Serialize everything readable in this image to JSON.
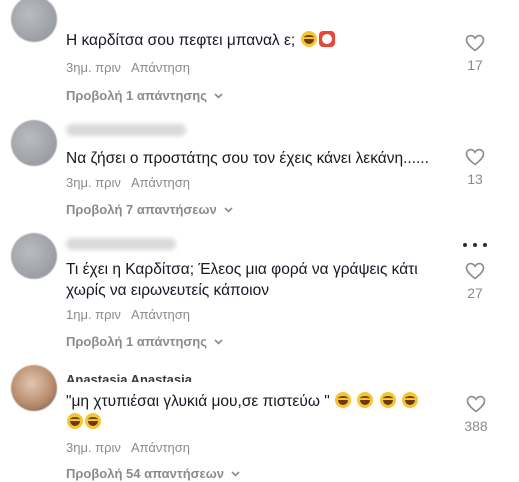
{
  "comments": [
    {
      "username": "",
      "text": "Η καρδίτσα σου πεφτει μπαναλ ε;",
      "text_emojis": [
        "grin-squint-icon",
        "clown-icon"
      ],
      "time": "3ημ. πριν",
      "reply": "Απάντηση",
      "likes": "17",
      "view_replies": "Προβολή 1 απάντησης"
    },
    {
      "username": "",
      "text": "Να ζήσει ο προστάτης σου τον έχεις κάνει λεκάνη......",
      "time": "3ημ. πριν",
      "reply": "Απάντηση",
      "likes": "13",
      "view_replies": "Προβολή 7 απαντήσεων"
    },
    {
      "username": "",
      "text": "Τι έχει η Καρδίτσα; Έλεος μια φορά να γράψεις κάτι\nχωρίς να ειρωνευτείς κάποιον",
      "time": "1ημ. πριν",
      "reply": "Απάντηση",
      "likes": "27",
      "view_replies": "Προβολή 1 απάντησης"
    },
    {
      "username": "Anastasia Anastasia",
      "text": "\"μη χτυπιέσαι γλυκιά μου,σε πιστεύω \"",
      "text_emojis": [
        "grin-squint-icon",
        "grin-squint-icon",
        "grin-squint-icon",
        "grin-squint-icon",
        "grin-squint-icon",
        "grin-squint-icon"
      ],
      "time": "3ημ. πριν",
      "reply": "Απάντηση",
      "likes": "388",
      "view_replies": "Προβολή 54 απαντήσεων"
    }
  ],
  "colors": {
    "text": "#161823",
    "muted": "#8a8b91"
  }
}
